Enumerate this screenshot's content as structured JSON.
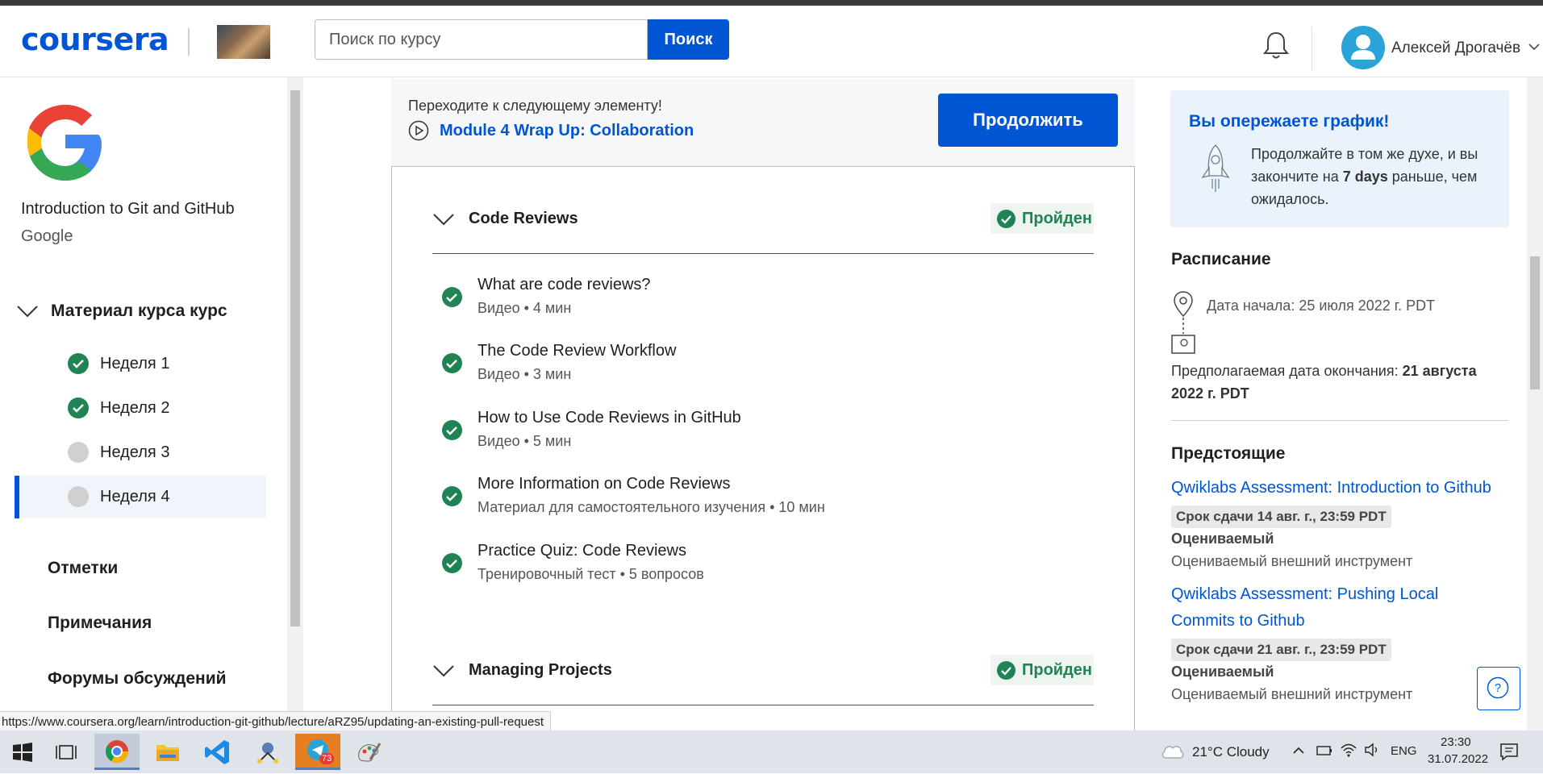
{
  "header": {
    "logo": "coursera",
    "search_placeholder": "Поиск по курсу",
    "search_button": "Поиск",
    "user_name": "Алексей Дрогачёв"
  },
  "sidebar": {
    "course_title": "Introduction to Git and GitHub",
    "course_org": "Google",
    "material_title": "Материал курса курс",
    "weeks": [
      {
        "label": "Неделя 1",
        "status": "done"
      },
      {
        "label": "Неделя 2",
        "status": "done"
      },
      {
        "label": "Неделя 3",
        "status": "pending"
      },
      {
        "label": "Неделя 4",
        "status": "pending"
      }
    ],
    "links": [
      "Отметки",
      "Примечания",
      "Форумы обсуждений"
    ]
  },
  "banner": {
    "next_text": "Переходите к следующему элементу!",
    "next_item": "Module 4 Wrap Up: Collaboration",
    "continue_button": "Продолжить"
  },
  "sections": [
    {
      "title": "Code Reviews",
      "badge": "Пройден",
      "items": [
        {
          "name": "What are code reviews?",
          "meta": "Видео • 4 мин"
        },
        {
          "name": "The Code Review Workflow",
          "meta": "Видео • 3 мин"
        },
        {
          "name": "How to Use Code Reviews in GitHub",
          "meta": "Видео • 5 мин"
        },
        {
          "name": "More Information on Code Reviews",
          "meta": "Материал для самостоятельного изучения • 10 мин"
        },
        {
          "name": "Practice Quiz: Code Reviews",
          "meta": "Тренировочный тест • 5 вопросов"
        }
      ]
    },
    {
      "title": "Managing Projects",
      "badge": "Пройден",
      "items": []
    }
  ],
  "right": {
    "ahead_title": "Вы опережаете график!",
    "ahead_pre": "Продолжайте в том же духе, и вы закончите на ",
    "ahead_bold": "7 days",
    "ahead_post": " раньше, чем ожидалось.",
    "schedule_title": "Расписание",
    "start_date": "Дата начала: 25 июля 2022 г. PDT",
    "end_pre": "Предполагаемая дата окончания: ",
    "end_bold": "21 августа 2022 г. PDT",
    "upcoming_title": "Предстоящие",
    "upcoming": [
      {
        "link": "Qwiklabs Assessment: Introduction to Github",
        "due": "Срок сдачи 14 авг. г., 23:59 PDT",
        "graded": "Оцениваемый",
        "tool": "Оцениваемый внешний инструмент"
      },
      {
        "link": "Qwiklabs Assessment: Pushing Local Commits to Github",
        "due": "Срок сдачи 21 авг. г., 23:59 PDT",
        "graded": "Оцениваемый",
        "tool": "Оцениваемый внешний инструмент"
      }
    ]
  },
  "status_url": "https://www.coursera.org/learn/introduction-git-github/lecture/aRZ95/updating-an-existing-pull-request",
  "taskbar": {
    "weather": "21°C  Cloudy",
    "lang": "ENG",
    "time": "23:30",
    "date": "31.07.2022",
    "telegram_badge": "73"
  },
  "colors": {
    "brand": "#0056d2",
    "success": "#1f8354"
  }
}
